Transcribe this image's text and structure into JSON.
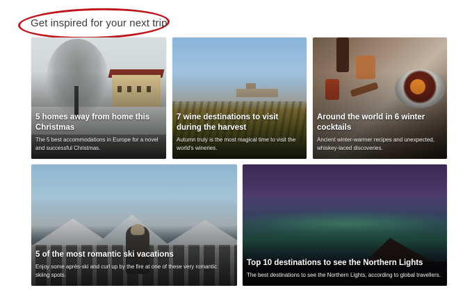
{
  "section": {
    "heading": "Get inspired for your next trip",
    "highlight_color": "#c0141b"
  },
  "cards": [
    {
      "title": "5 homes away from home this Christmas",
      "description": "The 5 best accommodations in Europe for a novel and successful Christmas."
    },
    {
      "title": "7 wine destinations to visit during the harvest",
      "description": "Autumn truly is the most magical time to visit the world's wineries."
    },
    {
      "title": "Around the world in 6 winter cocktails",
      "description": "Ancient winter-warmer recipes and unexpected, whiskey-laced discoveries."
    },
    {
      "title": "5 of the most romantic ski vacations",
      "description": "Enjoy some après-ski and curl up by the fire at one of these very romantic skiing spots."
    },
    {
      "title": "Top 10 destinations to see the Northern Lights",
      "description": "The best destinations to see the Northern Lights, according to global travellers."
    }
  ]
}
